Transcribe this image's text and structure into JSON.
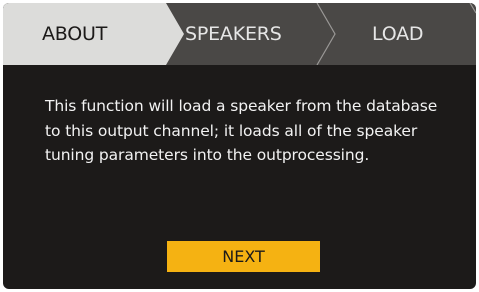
{
  "tabs": [
    {
      "label": "ABOUT",
      "active": true
    },
    {
      "label": "SPEAKERS",
      "active": false
    },
    {
      "label": "LOAD",
      "active": false
    }
  ],
  "description": "This function will load a speaker from the database to this output channel; it loads all of the speaker tuning parameters into the outprocessing.",
  "next_button": {
    "label": "NEXT"
  },
  "colors": {
    "background": "#1c1a19",
    "tab_active": "#dcdcda",
    "tab_inactive": "#4a4846",
    "accent": "#f5b212",
    "text": "#f2f2f2"
  }
}
